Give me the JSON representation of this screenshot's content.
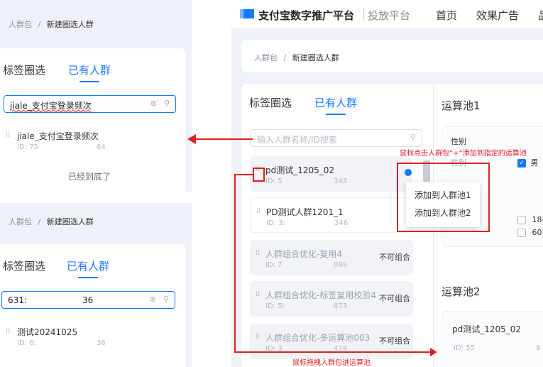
{
  "left_top": {
    "breadcrumb_root": "人群包",
    "breadcrumb_sep": "/",
    "breadcrumb_current": "新建圈选人群",
    "tab_tag": "标签圈选",
    "tab_existing": "已有人群",
    "search_value": "jiale_支付宝登录频次",
    "item_name": "jiale_支付宝登录频次",
    "item_id_label": "ID: 75",
    "item_id_tail": "64",
    "end_text": "已经到底了"
  },
  "left_bottom": {
    "breadcrumb_root": "人群包",
    "breadcrumb_sep": "/",
    "breadcrumb_current": "新建圈选人群",
    "tab_tag": "标签圈选",
    "tab_existing": "已有人群",
    "search_value_a": "631:",
    "search_value_b": "36",
    "item_name": "测试20241025",
    "item_id_label": "ID: 6:",
    "item_id_tail": "36"
  },
  "right": {
    "logo_text": "支付宝数字推广平台",
    "divider": "|",
    "platform_tag": "投放平台",
    "nav_home": "首页",
    "nav_ads": "效果广告",
    "nav_more": "品",
    "breadcrumb_root": "人群包",
    "breadcrumb_sep": "/",
    "breadcrumb_current": "新建圈选人群",
    "tab_tag": "标签圈选",
    "tab_existing": "已有人群",
    "search_placeholder": "输入人群名称/ID搜索",
    "items": [
      {
        "name": "pd测试_1205_02",
        "id": "ID: 5",
        "tail": "343",
        "badge": ""
      },
      {
        "name": "PD测试人群1201_1",
        "id": "ID: 3:",
        "tail": "346",
        "badge": ""
      },
      {
        "name": "人群组合优化-复用4",
        "id": "ID: 7",
        "tail": "099",
        "badge": "不可组合"
      },
      {
        "name": "人群组合优化-标签复用校验4",
        "id": "ID: 5I",
        "tail": "873",
        "badge": "不可组合"
      },
      {
        "name": "人群组合优化-多运算池003",
        "id": "ID: 3",
        "tail": "474",
        "badge": "不可组合"
      }
    ],
    "menu_items": [
      "添加到人群池1",
      "添加到人群池2"
    ],
    "pool1_title": "运算池1",
    "pool1_field": "性别",
    "pool1_field_shadow": "性别",
    "pool1_male": "男",
    "pool1_age_a": "18-",
    "pool1_age_b": "60)",
    "pool2_title": "运算池2",
    "pool2_item_name": "pd测试_1205_02",
    "pool2_item_id": "ID: 55",
    "pool2_item_tail": "8"
  },
  "annotations": {
    "click_hint": "鼠标点击人群包“+”添加到指定的运算池",
    "drag_hint": "鼠标拖拽人群包进运算池"
  },
  "colors": {
    "accent": "#1677ff",
    "annotation": "#e02020",
    "panel_bg": "#eef1f8"
  }
}
